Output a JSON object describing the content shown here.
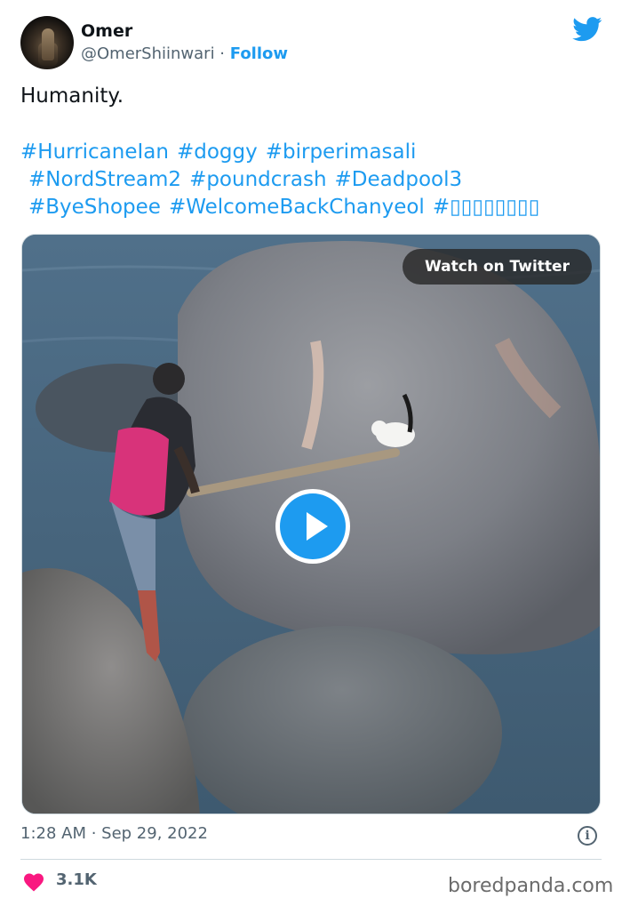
{
  "author": {
    "name": "Omer",
    "handle": "@OmerShiinwari",
    "separator": " · ",
    "follow_label": "Follow"
  },
  "tweet": {
    "text": "Humanity.",
    "hashtag_lines": [
      [
        "#HurricaneIan",
        "#doggy",
        "#birperimasali"
      ],
      [
        "#NordStream2",
        "#poundcrash",
        "#Deadpool3"
      ],
      [
        "#ByeShopee",
        "#WelcomeBackChanyeol",
        "#▯▯▯▯▯▯▯▯"
      ]
    ]
  },
  "media": {
    "watch_label": "Watch on Twitter",
    "play_icon": "play-icon"
  },
  "footer": {
    "timestamp": "1:28 AM · Sep 29, 2022",
    "info_glyph": "i",
    "like_count": "3.1K"
  },
  "watermark": "boredpanda.com",
  "colors": {
    "accent": "#1d9bf0",
    "heart": "#f91880",
    "secondary_text": "#536471"
  },
  "icons": [
    "twitter-bird-icon",
    "play-icon",
    "info-icon",
    "heart-icon"
  ]
}
